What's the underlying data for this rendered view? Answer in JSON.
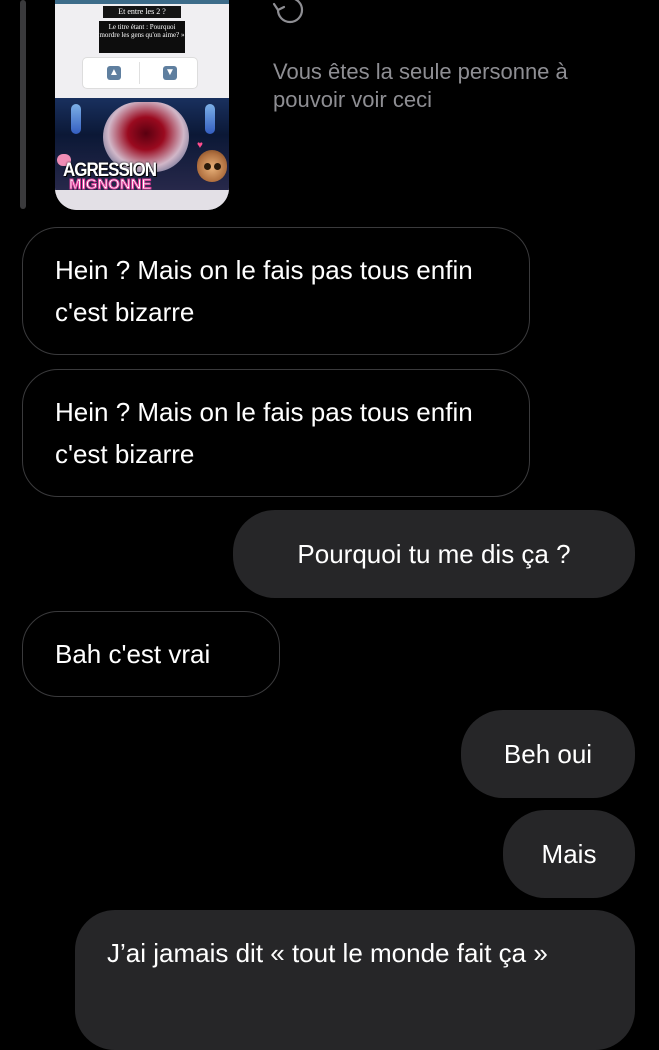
{
  "story": {
    "caption_top": "Et entre les 2 ?",
    "caption_sub": "Le titre étant : Pourquoi mordre les gens qu'on aime? »",
    "vote_up_icon": "double-chevron-up-icon",
    "vote_down_icon": "double-chevron-down-icon",
    "title_line1": "AGRESSION",
    "title_line2": "MIGNONNE"
  },
  "private_note": "Vous êtes la seule personne à pouvoir voir ceci",
  "messages": [
    {
      "side": "received",
      "text": "Hein ? Mais on le fais pas tous enfin c'est bizarre"
    },
    {
      "side": "received",
      "text": "Hein ? Mais on le fais pas tous enfin c'est bizarre"
    },
    {
      "side": "sent",
      "text": "Pourquoi tu me dis ça ?"
    },
    {
      "side": "received",
      "text": "Bah c'est vrai"
    },
    {
      "side": "sent",
      "text": "Beh oui"
    },
    {
      "side": "sent",
      "text": "Mais"
    },
    {
      "side": "sent",
      "text": "J’ai jamais dit « tout le monde fait ça »"
    }
  ],
  "colors": {
    "background": "#000000",
    "sent_bubble": "#262628",
    "received_border": "#3a3a3c",
    "muted_text": "#8e8e93"
  }
}
